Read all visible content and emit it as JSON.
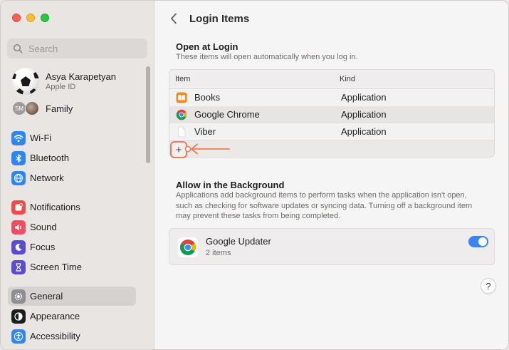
{
  "sidebar": {
    "search_placeholder": "Search",
    "profile": {
      "name": "Asya Karapetyan",
      "subtitle": "Apple ID"
    },
    "family": {
      "initials": "SM",
      "label": "Family"
    },
    "items": [
      {
        "label": "Wi-Fi",
        "icon": "wifi-icon",
        "color": "#2e86f5"
      },
      {
        "label": "Bluetooth",
        "icon": "bluetooth-icon",
        "color": "#2e86f5"
      },
      {
        "label": "Network",
        "icon": "globe-icon",
        "color": "#2e86f5"
      },
      {
        "label": "Notifications",
        "icon": "bell-icon",
        "color": "#ef4b4b"
      },
      {
        "label": "Sound",
        "icon": "speaker-icon",
        "color": "#ef4b63"
      },
      {
        "label": "Focus",
        "icon": "moon-icon",
        "color": "#5a4bd1"
      },
      {
        "label": "Screen Time",
        "icon": "hourglass-icon",
        "color": "#5a4bd1"
      },
      {
        "label": "General",
        "icon": "gear-icon",
        "color": "#8e8e93",
        "selected": true
      },
      {
        "label": "Appearance",
        "icon": "appearance-icon",
        "color": "#1d1d1f"
      },
      {
        "label": "Accessibility",
        "icon": "accessibility-icon",
        "color": "#2e86f5"
      }
    ]
  },
  "main": {
    "title": "Login Items",
    "open_at_login": {
      "title": "Open at Login",
      "description": "These items will open automatically when you log in.",
      "columns": {
        "item": "Item",
        "kind": "Kind"
      },
      "rows": [
        {
          "name": "Books",
          "kind": "Application",
          "icon": "books-icon"
        },
        {
          "name": "Google Chrome",
          "kind": "Application",
          "icon": "chrome-icon"
        },
        {
          "name": "Viber",
          "kind": "Application",
          "icon": "document-icon"
        }
      ],
      "add_label": "+"
    },
    "background": {
      "title": "Allow in the Background",
      "description": "Applications add background items to perform tasks when the application isn't open, such as checking for software updates or syncing data. Turning off a background item may prevent these tasks from being completed.",
      "items": [
        {
          "name": "Google Updater",
          "sub": "2 items",
          "enabled": true
        }
      ]
    },
    "help_label": "?"
  },
  "colors": {
    "accent": "#3a82f7",
    "highlight": "#ec7b53"
  }
}
